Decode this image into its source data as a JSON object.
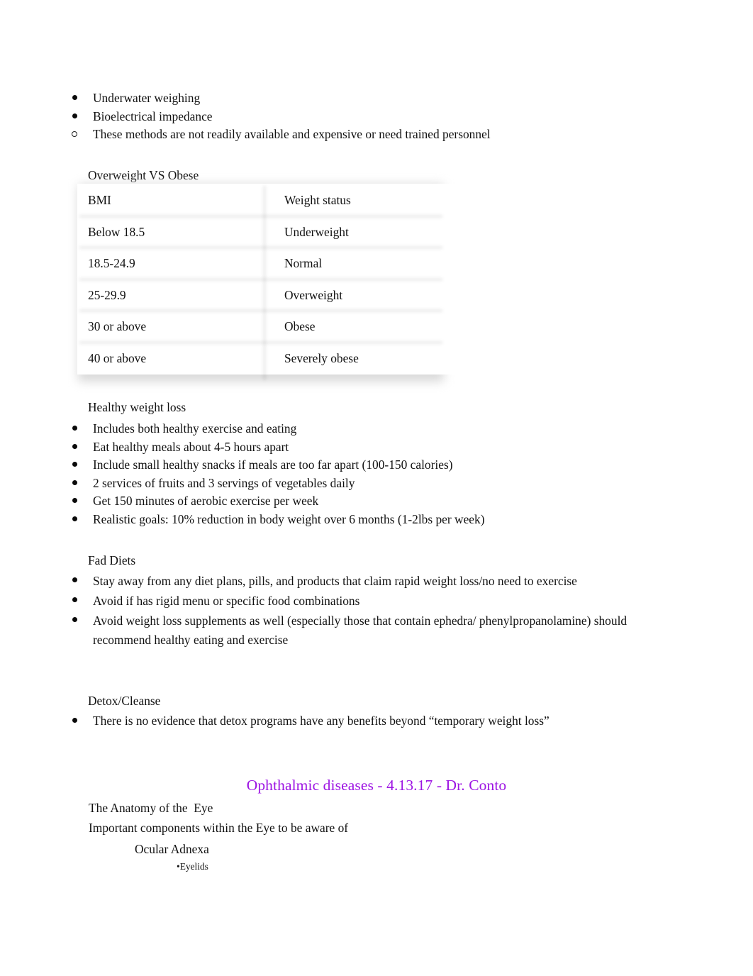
{
  "document": {
    "background_color": "#ffffff",
    "text_color": "#111111"
  },
  "top_list": {
    "items": [
      {
        "marker": "disc",
        "text": "Underwater weighing"
      },
      {
        "marker": "disc",
        "text": "Bioelectrical impedance"
      },
      {
        "marker": "circle",
        "text": "These methods are not readily available and expensive or need trained personnel"
      }
    ]
  },
  "overweight_section": {
    "heading": "Overweight VS Obese",
    "table": {
      "columns": [
        "BMI",
        "Weight status"
      ],
      "rows": [
        [
          "Below 18.5",
          "Underweight"
        ],
        [
          "18.5-24.9",
          "Normal"
        ],
        [
          "25-29.9",
          "Overweight"
        ],
        [
          "30 or above",
          "Obese"
        ],
        [
          "40 or above",
          "Severely obese"
        ]
      ]
    }
  },
  "healthy_weight_loss": {
    "heading": "Healthy weight loss",
    "items": [
      {
        "marker": "disc",
        "text": "Includes both healthy exercise and eating"
      },
      {
        "marker": "disc",
        "text": "Eat healthy meals about 4-5 hours apart"
      },
      {
        "marker": "disc",
        "text": "Include small healthy snacks if meals are too far apart (100-150 calories)"
      },
      {
        "marker": "disc",
        "text": "2 services of fruits and 3 servings of vegetables daily"
      },
      {
        "marker": "disc",
        "text": "Get 150 minutes of aerobic exercise per week"
      },
      {
        "marker": "disc",
        "text": "Realistic goals: 10% reduction in body weight over 6 months (1-2lbs per week)"
      }
    ]
  },
  "fad_diets": {
    "heading": "Fad Diets",
    "items": [
      {
        "marker": "disc",
        "text": "Stay away from any diet plans, pills, and products that claim rapid weight loss/no need to exercise"
      },
      {
        "marker": "disc",
        "text": "Avoid if has rigid menu or specific food combinations"
      },
      {
        "marker": "disc",
        "text": "Avoid weight loss supplements as well (especially those that contain ephedra/ phenylpropanolamine) should recommend healthy eating and exercise"
      }
    ]
  },
  "detox_cleanse": {
    "heading": "Detox/Cleanse",
    "items": [
      {
        "marker": "disc",
        "text": "There is no evidence that detox programs have any benefits beyond “temporary weight loss”"
      }
    ]
  },
  "lecture": {
    "heading": "Ophthalmic diseases - 4.13.17 - Dr. Conto",
    "heading_color": "#9d14e3"
  },
  "anatomy": {
    "title": "The Anatomy of the  Eye",
    "subtitle": "Important components within the Eye to be aware of",
    "ocular_adnexa": "Ocular Adnexa",
    "eyelids": "•Eyelids"
  }
}
